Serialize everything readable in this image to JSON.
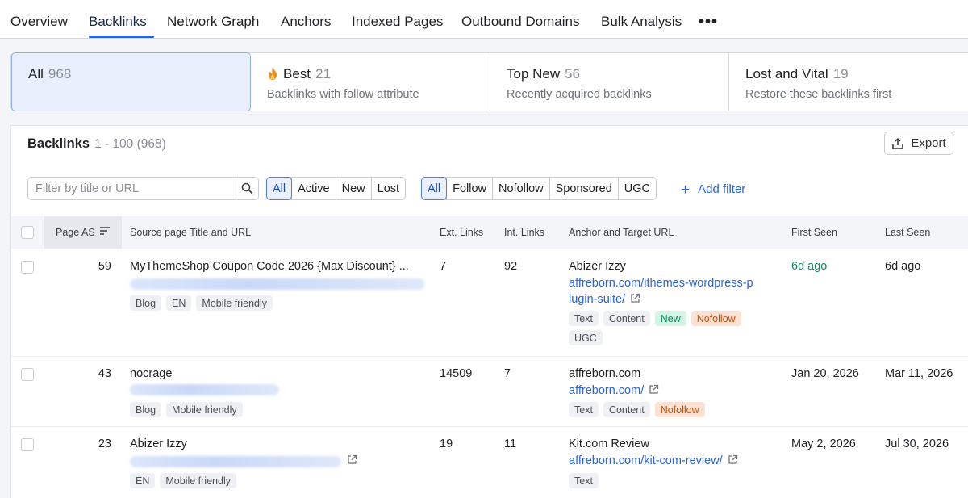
{
  "tabs": [
    "Overview",
    "Backlinks",
    "Network Graph",
    "Anchors",
    "Indexed Pages",
    "Outbound Domains",
    "Bulk Analysis"
  ],
  "more_label": "•••",
  "cards": [
    {
      "title": "All",
      "count": "968",
      "subtitle": ""
    },
    {
      "title": "Best",
      "count": "21",
      "subtitle": "Backlinks with follow attribute"
    },
    {
      "title": "Top New",
      "count": "56",
      "subtitle": "Recently acquired backlinks"
    },
    {
      "title": "Lost and Vital",
      "count": "19",
      "subtitle": "Restore these backlinks first"
    }
  ],
  "panel": {
    "title": "Backlinks",
    "range": "1 - 100 (968)",
    "export_label": "Export"
  },
  "filters": {
    "search_placeholder": "Filter by title or URL",
    "status": [
      "All",
      "Active",
      "New",
      "Lost"
    ],
    "type": [
      "All",
      "Follow",
      "Nofollow",
      "Sponsored",
      "UGC"
    ],
    "add_filter": "Add filter"
  },
  "columns": {
    "page_as": "Page AS",
    "source": "Source page Title and URL",
    "ext_links": "Ext. Links",
    "int_links": "Int. Links",
    "anchor": "Anchor and Target URL",
    "first_seen": "First Seen",
    "last_seen": "Last Seen"
  },
  "rows": [
    {
      "page_as": "59",
      "title": "MyThemeShop Coupon Code 2026 {Max Discount} ...",
      "source_tags": [
        "Blog",
        "EN",
        "Mobile friendly"
      ],
      "ext_links": "7",
      "int_links": "92",
      "anchor": "Abizer Izzy",
      "target_line1": "affreborn.com/ithemes-wordpress-p",
      "target_line2": "lugin-suite/",
      "anchor_tags": [
        "Text",
        "Content",
        "New",
        "Nofollow"
      ],
      "anchor_tags2": [
        "UGC"
      ],
      "first_seen": "6d ago",
      "last_seen": "6d ago"
    },
    {
      "page_as": "43",
      "title": "nocrage",
      "source_tags": [
        "Blog",
        "Mobile friendly"
      ],
      "ext_links": "14509",
      "int_links": "7",
      "anchor": "affreborn.com",
      "target_line1": "affreborn.com/",
      "anchor_tags": [
        "Text",
        "Content",
        "Nofollow"
      ],
      "first_seen": "Jan 20, 2026",
      "last_seen": "Mar 11, 2026"
    },
    {
      "page_as": "23",
      "title": "Abizer Izzy",
      "source_tags": [
        "EN",
        "Mobile friendly"
      ],
      "ext_links": "19",
      "int_links": "11",
      "anchor": "Kit.com Review",
      "target_line1": "affreborn.com/kit-com-review/",
      "anchor_tags": [
        "Text"
      ],
      "first_seen": "May 2, 2026",
      "last_seen": "Jul 30, 2026"
    }
  ],
  "colors": {
    "accent": "#2b63d9",
    "new_green": "#128a5b",
    "nofollow_orange": "#c44f12"
  }
}
